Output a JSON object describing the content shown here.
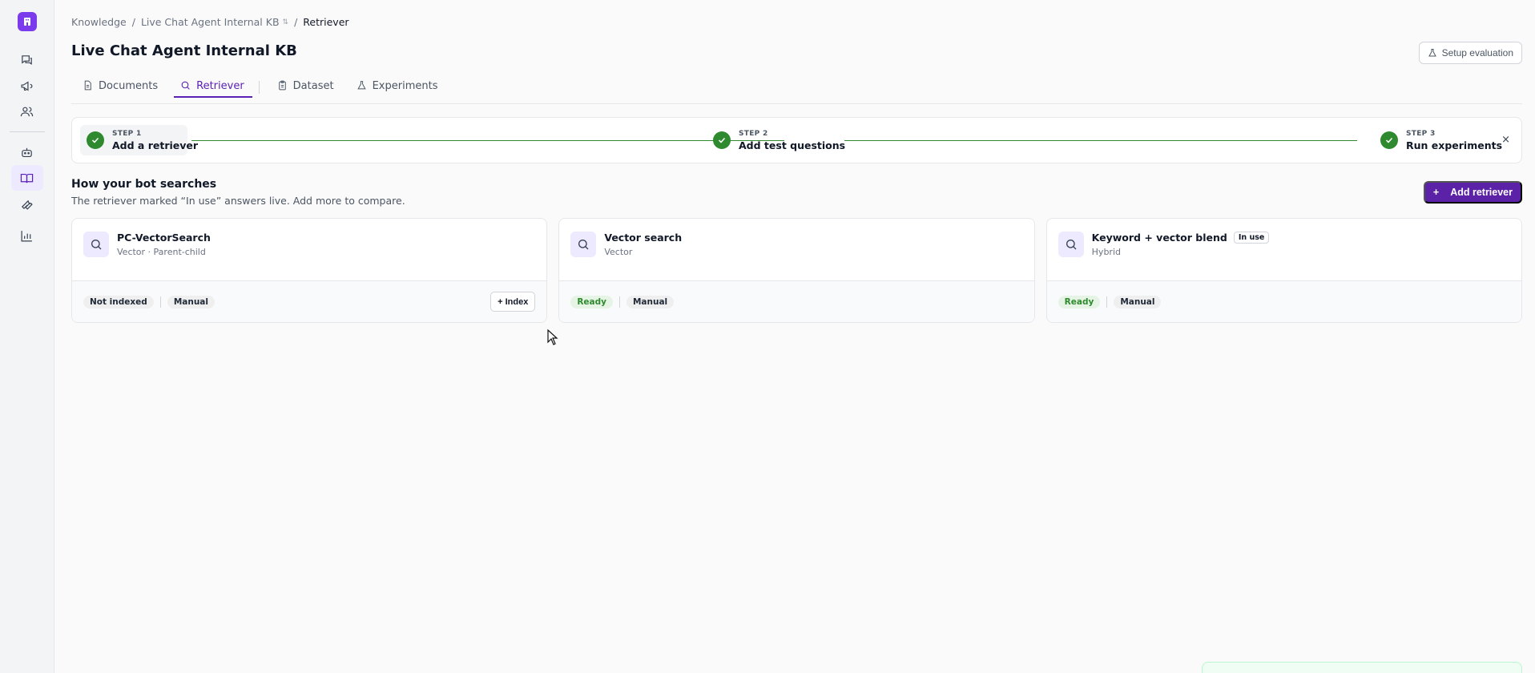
{
  "breadcrumb": {
    "root": "Knowledge",
    "sep1": "/",
    "kb": "Live Chat Agent Internal KB",
    "sep2": "/",
    "current": "Retriever"
  },
  "page": {
    "title": "Live Chat Agent Internal KB",
    "setup_button": "Setup evaluation"
  },
  "tabs": [
    {
      "label": "Documents",
      "icon": "document-icon"
    },
    {
      "label": "Retriever",
      "icon": "search-icon",
      "active": true
    },
    {
      "label": "Dataset",
      "icon": "clipboard-icon"
    },
    {
      "label": "Experiments",
      "icon": "flask-icon"
    }
  ],
  "stepper": {
    "steps": [
      {
        "kicker": "STEP 1",
        "label": "Add a retriever",
        "status": "complete"
      },
      {
        "kicker": "STEP 2",
        "label": "Add test questions",
        "status": "complete"
      },
      {
        "kicker": "STEP 3",
        "label": "Run experiments",
        "status": "complete"
      }
    ],
    "close": "×"
  },
  "section": {
    "title": "How your bot searches",
    "subtitle": "The retriever marked “In use” answers live. Add more to compare.",
    "add_button": "Add retriever"
  },
  "cards": [
    {
      "name": "PC-VectorSearch",
      "type": "Vector · Parent-child",
      "status": "Not indexed",
      "mode": "Manual",
      "action": "+ Index"
    },
    {
      "name": "Vector search",
      "type": "Vector",
      "status": "Ready",
      "mode": "Manual"
    },
    {
      "name": "Keyword + vector blend",
      "type": "Hybrid",
      "badge": "In use",
      "status": "Ready",
      "mode": "Manual"
    }
  ],
  "colors": {
    "accent": "#5b21a6",
    "success": "#2f8a2f",
    "logo": "#7c3aed"
  }
}
